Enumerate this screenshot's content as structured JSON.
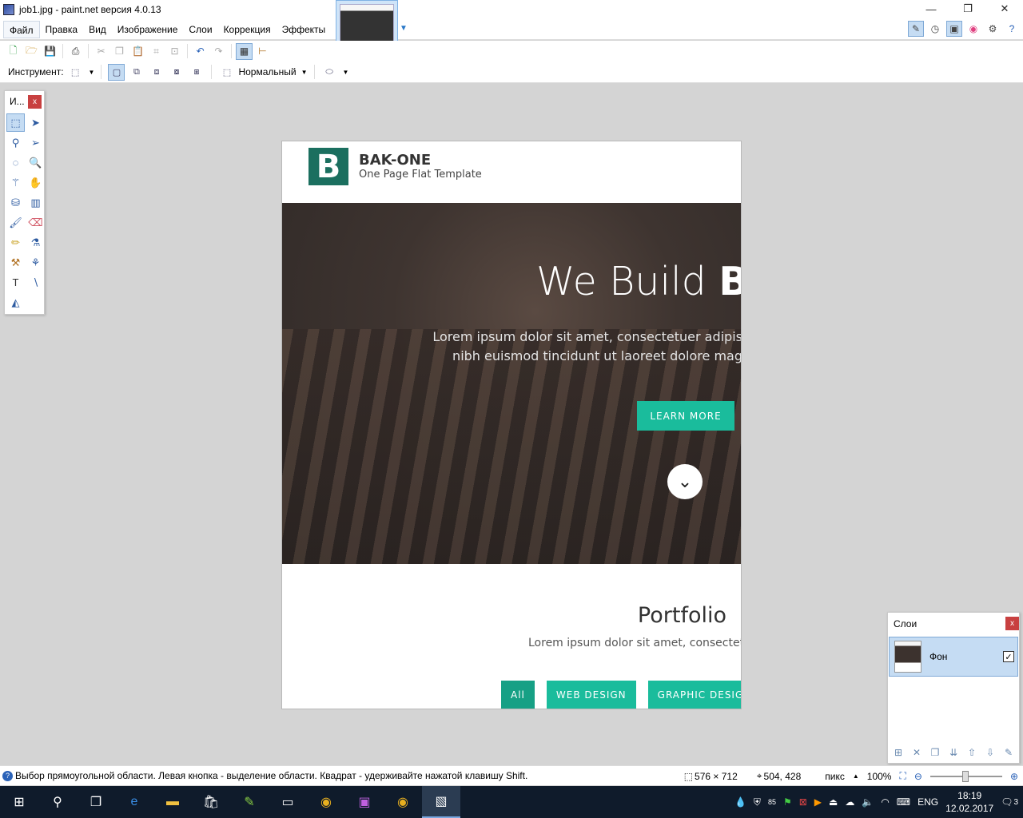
{
  "window": {
    "title": "job1.jpg - paint.net версия 4.0.13",
    "controls": [
      "—",
      "❐",
      "✕"
    ]
  },
  "menu": [
    "Файл",
    "Правка",
    "Вид",
    "Изображение",
    "Слои",
    "Коррекция",
    "Эффекты"
  ],
  "options_bar": {
    "tool_label": "Инструмент:",
    "blend_mode": "Нормальный"
  },
  "tools_window": {
    "title": "И...",
    "close": "x"
  },
  "image": {
    "brand": "BAK-ONE",
    "brand_letter": "B",
    "tagline": "One Page Flat Template",
    "hero_title": "We Build ",
    "hero_title_bold": "B",
    "hero_line1": "Lorem ipsum dolor sit amet, consectetuer adipis",
    "hero_line2": "nibh euismod tincidunt ut laoreet dolore mag",
    "learn_more": "LEARN MORE",
    "portfolio_title": "Portfolio",
    "portfolio_text": "Lorem ipsum dolor sit amet, consectetu",
    "filters": [
      "All",
      "WEB DESIGN",
      "GRAPHIC DESIG"
    ]
  },
  "layers_panel": {
    "title": "Слои",
    "close": "x",
    "layer_name": "Фон",
    "checked": "✓"
  },
  "status": {
    "help_text": "Выбор прямоугольной области. Левая кнопка - выделение области. Квадрат - удерживайте нажатой клавишу Shift.",
    "image_size": "576 × 712",
    "cursor": "504, 428",
    "units": "пикс",
    "zoom": "100%"
  },
  "taskbar": {
    "lang": "ENG",
    "time": "18:19",
    "date": "12.02.2017",
    "notification_count": "3",
    "tray_badge": "85"
  }
}
